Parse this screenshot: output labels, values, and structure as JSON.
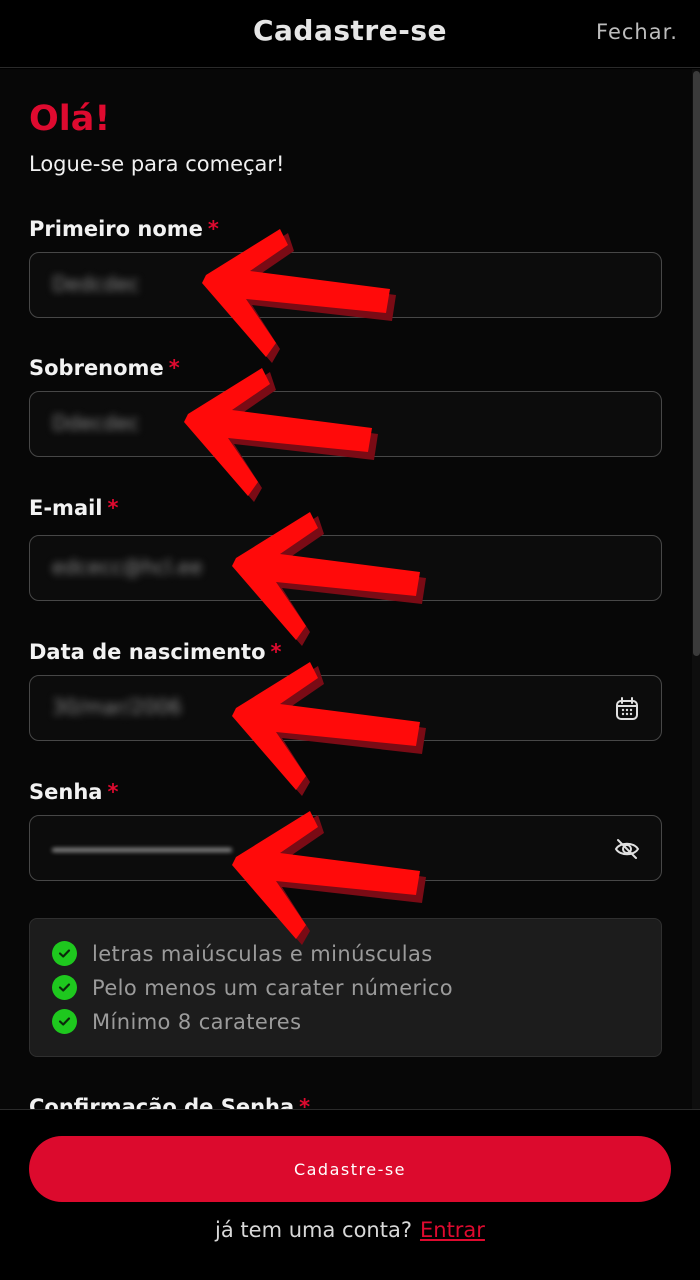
{
  "header": {
    "title": "Cadastre-se",
    "close_label": "Fechar."
  },
  "greeting": {
    "title": "Olá!",
    "subtitle": "Logue-se para começar!"
  },
  "form": {
    "required_mark": "*",
    "first_name": {
      "label": "Primeiro nome",
      "value": "Dedcdec"
    },
    "last_name": {
      "label": "Sobrenome",
      "value": "Ddecdec"
    },
    "email": {
      "label": "E-mail",
      "value": "edcecc@hcl.ee"
    },
    "birth_date": {
      "label": "Data de nascimento",
      "value": "30/mar/2006"
    },
    "password": {
      "label": "Senha"
    },
    "password_rules": [
      "letras maiúsculas e minúsculas",
      "Pelo menos um carater númerico",
      "Mínimo 8 carateres"
    ],
    "confirm_password": {
      "label": "Confirmação de Senha"
    }
  },
  "footer": {
    "submit_label": "Cadastre-se",
    "have_account": "já tem uma conta?",
    "login_link": "Entrar"
  },
  "colors": {
    "accent": "#dc0a2d",
    "check": "#1ec81e",
    "background": "#000000"
  }
}
